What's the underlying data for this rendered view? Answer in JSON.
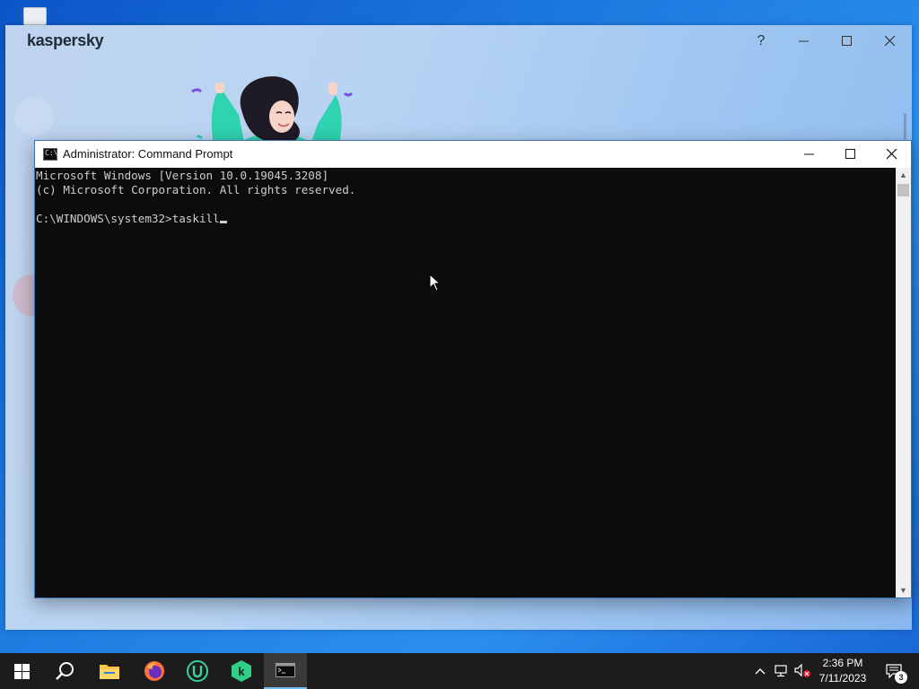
{
  "kaspersky": {
    "logo": "kaspersky",
    "help_label": "?",
    "brand_color": "#2ec4a0"
  },
  "cmd": {
    "title": "Administrator: Command Prompt",
    "lines": [
      "Microsoft Windows [Version 10.0.19045.3208]",
      "(c) Microsoft Corporation. All rights reserved.",
      "",
      "C:\\WINDOWS\\system32>taskill"
    ],
    "background": "#0c0c0c",
    "text_color": "#cccccc"
  },
  "taskbar": {
    "apps": [
      {
        "name": "start",
        "icon": "windows-logo-icon"
      },
      {
        "name": "search",
        "icon": "search-icon"
      },
      {
        "name": "file-explorer",
        "icon": "folder-icon"
      },
      {
        "name": "firefox",
        "icon": "firefox-icon"
      },
      {
        "name": "app-u",
        "icon": "u-circle-icon"
      },
      {
        "name": "kaspersky",
        "icon": "kaspersky-icon"
      },
      {
        "name": "command-prompt",
        "icon": "cmd-icon",
        "active": true
      }
    ],
    "clock": {
      "time": "2:36 PM",
      "date": "7/11/2023"
    },
    "notifications_count": "3"
  }
}
